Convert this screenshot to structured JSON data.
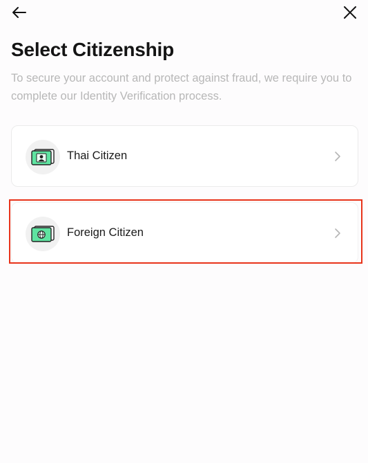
{
  "header": {
    "back_icon": "arrow-left-icon",
    "close_icon": "close-icon"
  },
  "page": {
    "title": "Select Citizenship",
    "subtitle": "To secure your account and protect against fraud, we require you to complete our Identity Verification process."
  },
  "options": [
    {
      "label": "Thai Citizen",
      "icon": "id-card-person-icon",
      "chevron": "chevron-right-icon"
    },
    {
      "label": "Foreign Citizen",
      "icon": "id-card-globe-icon",
      "chevron": "chevron-right-icon"
    }
  ],
  "colors": {
    "highlight": "#e8331a",
    "card_green": "#5fe3a1",
    "subtitle_text": "#b7b7b7"
  }
}
